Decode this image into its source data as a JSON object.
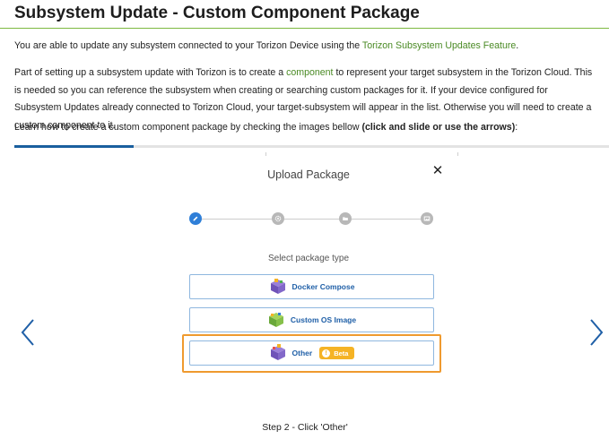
{
  "header": {
    "title": "Subsystem Update - Custom Component Package"
  },
  "paragraphs": {
    "p1_before": "You are able to update any subsystem connected to your Torizon Device using the ",
    "p1_link": "Torizon Subsystem Updates Feature",
    "p1_after": ".",
    "p2_before": "Part of setting up a subsystem update with Torizon is to create a ",
    "p2_link": "component",
    "p2_after": " to represent your target subsystem in the Torizon Cloud. This is needed so you can reference the subsystem when creating or searching custom packages for it. If your device configured for Subsystem Updates already connected to Torizon Cloud, your target-subsystem will appear in the list. Otherwise you will need to create a custom component to it.",
    "p3_before": "Learn how to create a custom component package by checking the images bellow ",
    "p3_bold": "(click and slide or use the arrows)",
    "p3_after": ":"
  },
  "modal": {
    "title": "Upload Package",
    "select_label": "Select package type",
    "options": [
      {
        "label": "Docker Compose",
        "icon": "cube-purple-icon"
      },
      {
        "label": "Custom OS Image",
        "icon": "cube-green-icon"
      },
      {
        "label": "Other",
        "icon": "cube-purple-icon",
        "badge": "Beta"
      }
    ],
    "steps": [
      "pencil-icon",
      "gear-icon",
      "folder-icon",
      "image-icon"
    ]
  },
  "carousel": {
    "caption": "Step 2 - Click 'Other'"
  },
  "colors": {
    "accent_green": "#7db93f",
    "link_green": "#4a8a24",
    "active_blue": "#2f7fd8",
    "tab_blue": "#1a5f9e",
    "highlight_orange": "#ef9a2f",
    "beta_yellow": "#f5b325"
  }
}
